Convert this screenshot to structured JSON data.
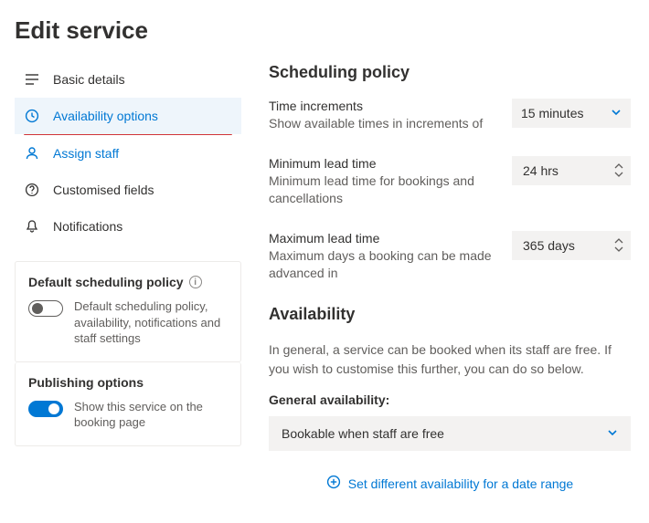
{
  "page_title": "Edit service",
  "nav": {
    "basic_details": "Basic details",
    "availability_options": "Availability options",
    "assign_staff": "Assign staff",
    "customised_fields": "Customised fields",
    "notifications": "Notifications"
  },
  "cards": {
    "default_policy": {
      "title": "Default scheduling policy",
      "desc": "Default scheduling policy, availability, notifications and staff settings"
    },
    "publishing": {
      "title": "Publishing options",
      "desc": "Show this service on the booking page"
    }
  },
  "scheduling": {
    "heading": "Scheduling policy",
    "time_increments": {
      "label": "Time increments",
      "desc": "Show available times in increments of",
      "value": "15 minutes"
    },
    "min_lead": {
      "label": "Minimum lead time",
      "desc": "Minimum lead time for bookings and cancellations",
      "value": "24 hrs"
    },
    "max_lead": {
      "label": "Maximum lead time",
      "desc": "Maximum days a booking can be made advanced in",
      "value": "365 days"
    }
  },
  "availability": {
    "heading": "Availability",
    "body": "In general, a service can be booked when its staff are free. If you wish to customise this further, you can do so below.",
    "general_label": "General availability:",
    "general_value": "Bookable when staff are free",
    "add_link": "Set different availability for a date range"
  }
}
